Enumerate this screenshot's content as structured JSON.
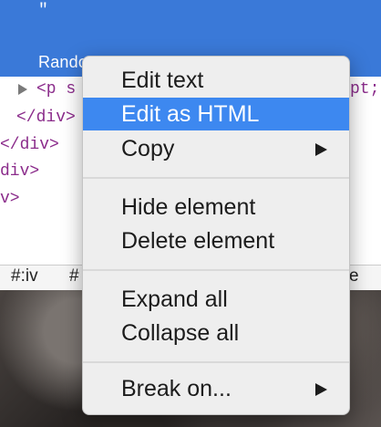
{
  "devtools": {
    "selected_quote": "\"",
    "selected_text": "Random Image",
    "dom_lines": [
      {
        "text": "<p s",
        "suffix": "pt;"
      },
      {
        "text": "</div>"
      },
      {
        "text": "</div>"
      },
      {
        "text": "div>"
      },
      {
        "text": "v>"
      }
    ],
    "breadcrumbs": [
      "#:iv",
      "#",
      "e"
    ]
  },
  "context_menu": {
    "items": [
      {
        "label": "Edit text",
        "highlighted": false,
        "submenu": false
      },
      {
        "label": "Edit as HTML",
        "highlighted": true,
        "submenu": false
      },
      {
        "label": "Copy",
        "highlighted": false,
        "submenu": true
      },
      {
        "label": "Hide element",
        "highlighted": false,
        "submenu": false
      },
      {
        "label": "Delete element",
        "highlighted": false,
        "submenu": false
      },
      {
        "label": "Expand all",
        "highlighted": false,
        "submenu": false
      },
      {
        "label": "Collapse all",
        "highlighted": false,
        "submenu": false
      },
      {
        "label": "Break on...",
        "highlighted": false,
        "submenu": true
      }
    ]
  },
  "colors": {
    "selection_bg": "#3a79d8",
    "menu_highlight": "#3d88f0",
    "tag_color": "#8b2c8b"
  }
}
